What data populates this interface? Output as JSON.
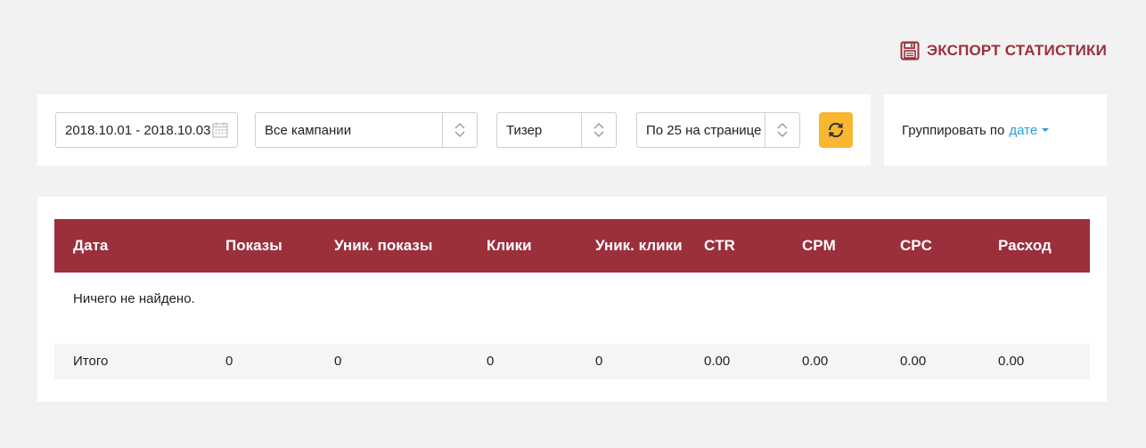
{
  "export": {
    "label": "ЭКСПОРТ СТАТИСТИКИ",
    "icon": "floppy-disk-icon",
    "color": "#9b2f3c"
  },
  "filters": {
    "date_range": "2018.10.01 - 2018.10.03",
    "campaign": "Все кампании",
    "ad_type": "Тизер",
    "per_page": "По 25 на странице"
  },
  "refresh": {
    "icon": "refresh-icon",
    "color": "#f7b731"
  },
  "grouping": {
    "label": "Группировать по",
    "value": "дате"
  },
  "table": {
    "columns": [
      "Дата",
      "Показы",
      "Уник. показы",
      "Клики",
      "Уник. клики",
      "CTR",
      "CPM",
      "CPC",
      "Расход"
    ],
    "empty_message": "Ничего не найдено.",
    "totals": [
      "Итого",
      "0",
      "0",
      "0",
      "0",
      "0.00",
      "0.00",
      "0.00",
      "0.00"
    ],
    "header_color": "#9b2f3c"
  }
}
